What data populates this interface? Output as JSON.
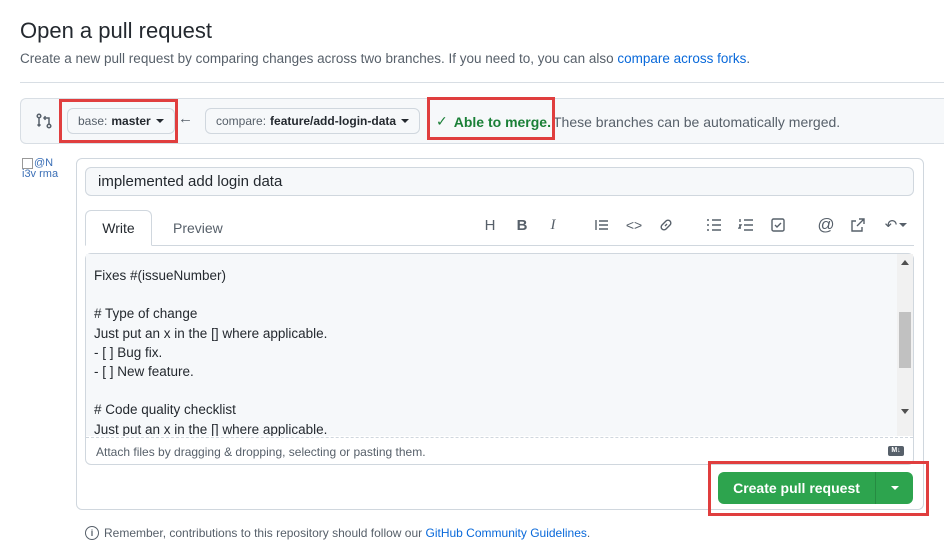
{
  "header": {
    "title": "Open a pull request",
    "subtitle": "Create a new pull request by comparing changes across two branches. If you need to, you can also ",
    "subtitle_link": "compare across forks",
    "subtitle_end": "."
  },
  "range": {
    "base_key": "base:",
    "base_value": "master",
    "compare_key": "compare:",
    "compare_value": "feature/add-login-data",
    "merge_status": "Able to merge.",
    "merge_note": "These branches can be automatically merged."
  },
  "avatar": {
    "alt": "@N i3v rma"
  },
  "form": {
    "title_value": "implemented add login data",
    "tabs": [
      "Write",
      "Preview"
    ],
    "toolbar": [
      "heading-icon",
      "bold-icon",
      "italic-icon",
      "quote-icon",
      "code-icon",
      "link-icon",
      "bullet-list-icon",
      "numbered-list-icon",
      "task-list-icon",
      "mention-icon",
      "reference-icon",
      "reply-icon"
    ],
    "body": "Fixes #(issueNumber)\n\n# Type of change\nJust put an x in the [] where applicable.\n- [ ] Bug fix.\n- [ ] New feature.\n\n# Code quality checklist\nJust put an x in the [] where applicable.",
    "attach_text": "Attach files by dragging & dropping, selecting or pasting them.",
    "md_badge": "M↓"
  },
  "actions": {
    "create_label": "Create pull request"
  },
  "footer": {
    "text": "Remember, contributions to this repository should follow our ",
    "link": "GitHub Community Guidelines",
    "end": "."
  },
  "colors": {
    "accent": "#2da44e",
    "link": "#0969da",
    "highlight": "#e03e3e",
    "merge_ok": "#1a7f37"
  }
}
